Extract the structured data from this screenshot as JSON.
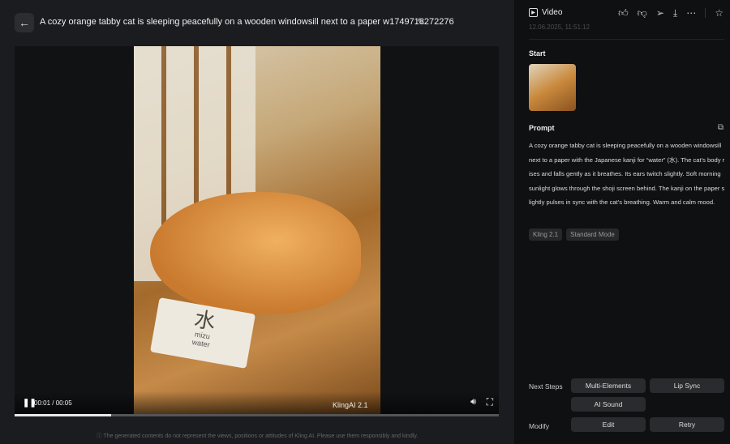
{
  "header": {
    "title": "A cozy orange tabby cat is sleeping peacefully on a wooden windowsill next to a paper w1749718272276"
  },
  "player": {
    "current": "00:01",
    "duration": "00:05",
    "time_label": "00:01 / 00:05",
    "progress_percent": 20,
    "watermark": "KlingAI 2.1",
    "card_kanji": "水",
    "card_romaji": "mizu",
    "card_english": "water"
  },
  "disclaimer": "ⓘ The generated contents do not represent the views, positions or attitudes of Kling AI. Please use them responsibly and kindly.",
  "panel": {
    "type": "Video",
    "date": "12.06.2025, 11:51:12",
    "start_label": "Start",
    "prompt_label": "Prompt",
    "prompt": "A cozy orange tabby cat is sleeping peacefully on a wooden windowsill next to a paper with the Japanese kanji for “water” (水). The cat’s body rises and falls gently as it breathes. Its ears twitch slightly. Soft morning sunlight glows through the shoji screen behind. The kanji on the paper slightly pulses in sync with the cat’s breathing. Warm and calm mood.",
    "tags": [
      "Kling 2.1",
      "Standard Mode"
    ],
    "next_steps_label": "Next Steps",
    "multi_elements": "Multi-Elements",
    "lip_sync": "Lip Sync",
    "ai_sound": "AI Sound",
    "modify_label": "Modify",
    "edit": "Edit",
    "retry": "Retry"
  }
}
